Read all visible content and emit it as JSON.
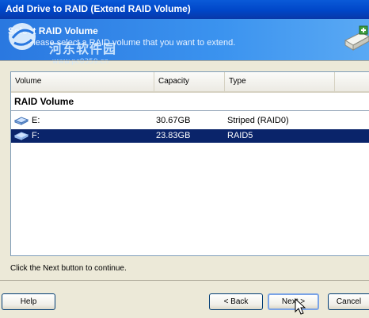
{
  "window": {
    "title": "Add Drive to RAID (Extend RAID Volume)"
  },
  "banner": {
    "title": "Select RAID Volume",
    "subtitle": "Please select a RAID volume that you want to extend.",
    "watermark": "河东软件园",
    "watermark_url": "www.pc0359.cn"
  },
  "list": {
    "columns": [
      "Volume",
      "Capacity",
      "Type"
    ],
    "group": "RAID Volume",
    "rows": [
      {
        "volume": "E:",
        "capacity": "30.67GB",
        "type": "Striped (RAID0)",
        "selected": false
      },
      {
        "volume": "F:",
        "capacity": "23.83GB",
        "type": "RAID5",
        "selected": true
      }
    ]
  },
  "hint": "Click the Next button to continue.",
  "buttons": {
    "help": "Help",
    "back": "< Back",
    "next": "Next >",
    "cancel": "Cancel"
  },
  "colors": {
    "selection": "#0a246a",
    "banner": "#3b93ef",
    "titlebar": "#0046c8"
  }
}
